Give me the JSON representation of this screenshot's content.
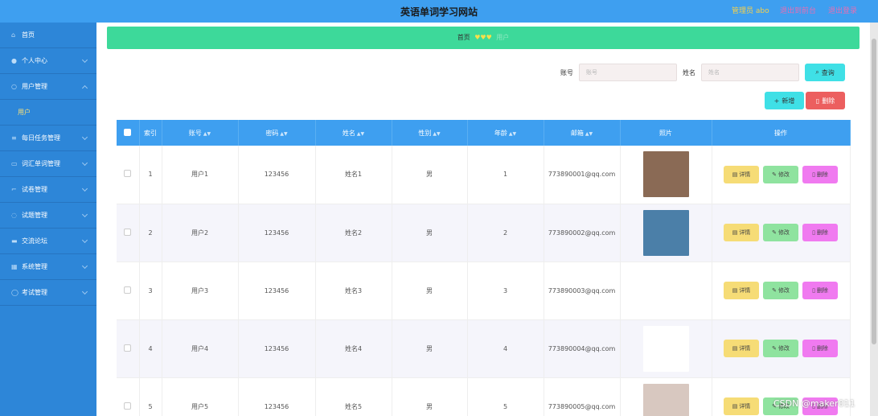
{
  "header": {
    "title": "英语单词学习网站",
    "admin": "管理员 abo",
    "back_to_front": "退出到前台",
    "logout": "退出登录"
  },
  "sidebar": {
    "items": [
      {
        "label": "首页",
        "icon": "home-icon"
      },
      {
        "label": "个人中心",
        "icon": "user-icon"
      },
      {
        "label": "用户管理",
        "icon": "users-icon"
      },
      {
        "label": "用户",
        "icon": ""
      },
      {
        "label": "每日任务管理",
        "icon": "list-icon"
      },
      {
        "label": "词汇单词管理",
        "icon": "book-icon"
      },
      {
        "label": "试卷管理",
        "icon": "paper-icon"
      },
      {
        "label": "试题管理",
        "icon": "question-icon"
      },
      {
        "label": "交流论坛",
        "icon": "forum-icon"
      },
      {
        "label": "系统管理",
        "icon": "grid-icon"
      },
      {
        "label": "考试管理",
        "icon": "exam-icon"
      }
    ]
  },
  "breadcrumb": {
    "home": "首页",
    "hearts": "♥♥♥",
    "current": "用户"
  },
  "search": {
    "account_label": "账号",
    "account_placeholder": "账号",
    "name_label": "姓名",
    "name_placeholder": "姓名",
    "query_button": "查询"
  },
  "actions": {
    "add": "新增",
    "delete": "删除"
  },
  "table": {
    "headers": [
      "索引",
      "账号",
      "密码",
      "姓名",
      "性别",
      "年龄",
      "邮箱",
      "照片",
      "操作"
    ],
    "rows": [
      {
        "index": "1",
        "account": "用户1",
        "password": "123456",
        "name": "姓名1",
        "gender": "男",
        "age": "1",
        "email": "773890001@qq.com",
        "photo_color": "#8a6a55"
      },
      {
        "index": "2",
        "account": "用户2",
        "password": "123456",
        "name": "姓名2",
        "gender": "男",
        "age": "2",
        "email": "773890002@qq.com",
        "photo_color": "#4b7fa8"
      },
      {
        "index": "3",
        "account": "用户3",
        "password": "123456",
        "name": "姓名3",
        "gender": "男",
        "age": "3",
        "email": "773890003@qq.com",
        "photo_color": "#ffffff"
      },
      {
        "index": "4",
        "account": "用户4",
        "password": "123456",
        "name": "姓名4",
        "gender": "男",
        "age": "4",
        "email": "773890004@qq.com",
        "photo_color": "#ffffff"
      },
      {
        "index": "5",
        "account": "用户5",
        "password": "123456",
        "name": "姓名5",
        "gender": "男",
        "age": "5",
        "email": "773890005@qq.com",
        "photo_color": "#d8c8c0"
      }
    ],
    "op_detail": "详情",
    "op_edit": "修改",
    "op_delete": "删除"
  },
  "watermark": "CSDN @maker011",
  "colors": {
    "topbar": "#3e9ff0",
    "sidebar": "#2d86d8",
    "breadcrumb": "#3dd99a",
    "table_header": "#3e9ff0"
  }
}
